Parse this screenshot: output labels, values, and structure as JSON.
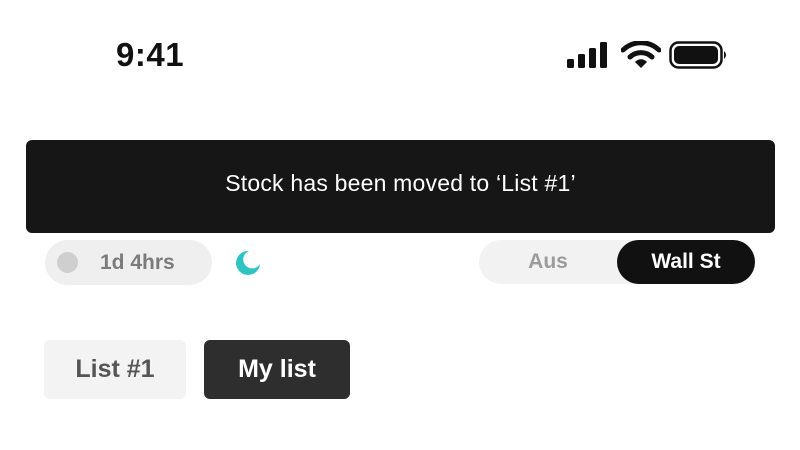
{
  "status_bar": {
    "time": "9:41",
    "icons": [
      "cellular-signal-icon",
      "wifi-icon",
      "battery-icon"
    ]
  },
  "toast": {
    "message": "Stock has been moved to ‘List #1’"
  },
  "market": {
    "timer_label": "1d 4hrs",
    "night_icon": "moon-icon",
    "options": [
      "Aus",
      "Wall St"
    ],
    "selected": "Wall St"
  },
  "lists": {
    "tabs": [
      {
        "label": "List #1",
        "active": false
      },
      {
        "label": "My list",
        "active": true
      }
    ]
  },
  "colors": {
    "toast_bg": "#161616",
    "moon_accent": "#2ec4c4",
    "active_segment": "#111111",
    "active_tab": "#2e2e2e"
  }
}
